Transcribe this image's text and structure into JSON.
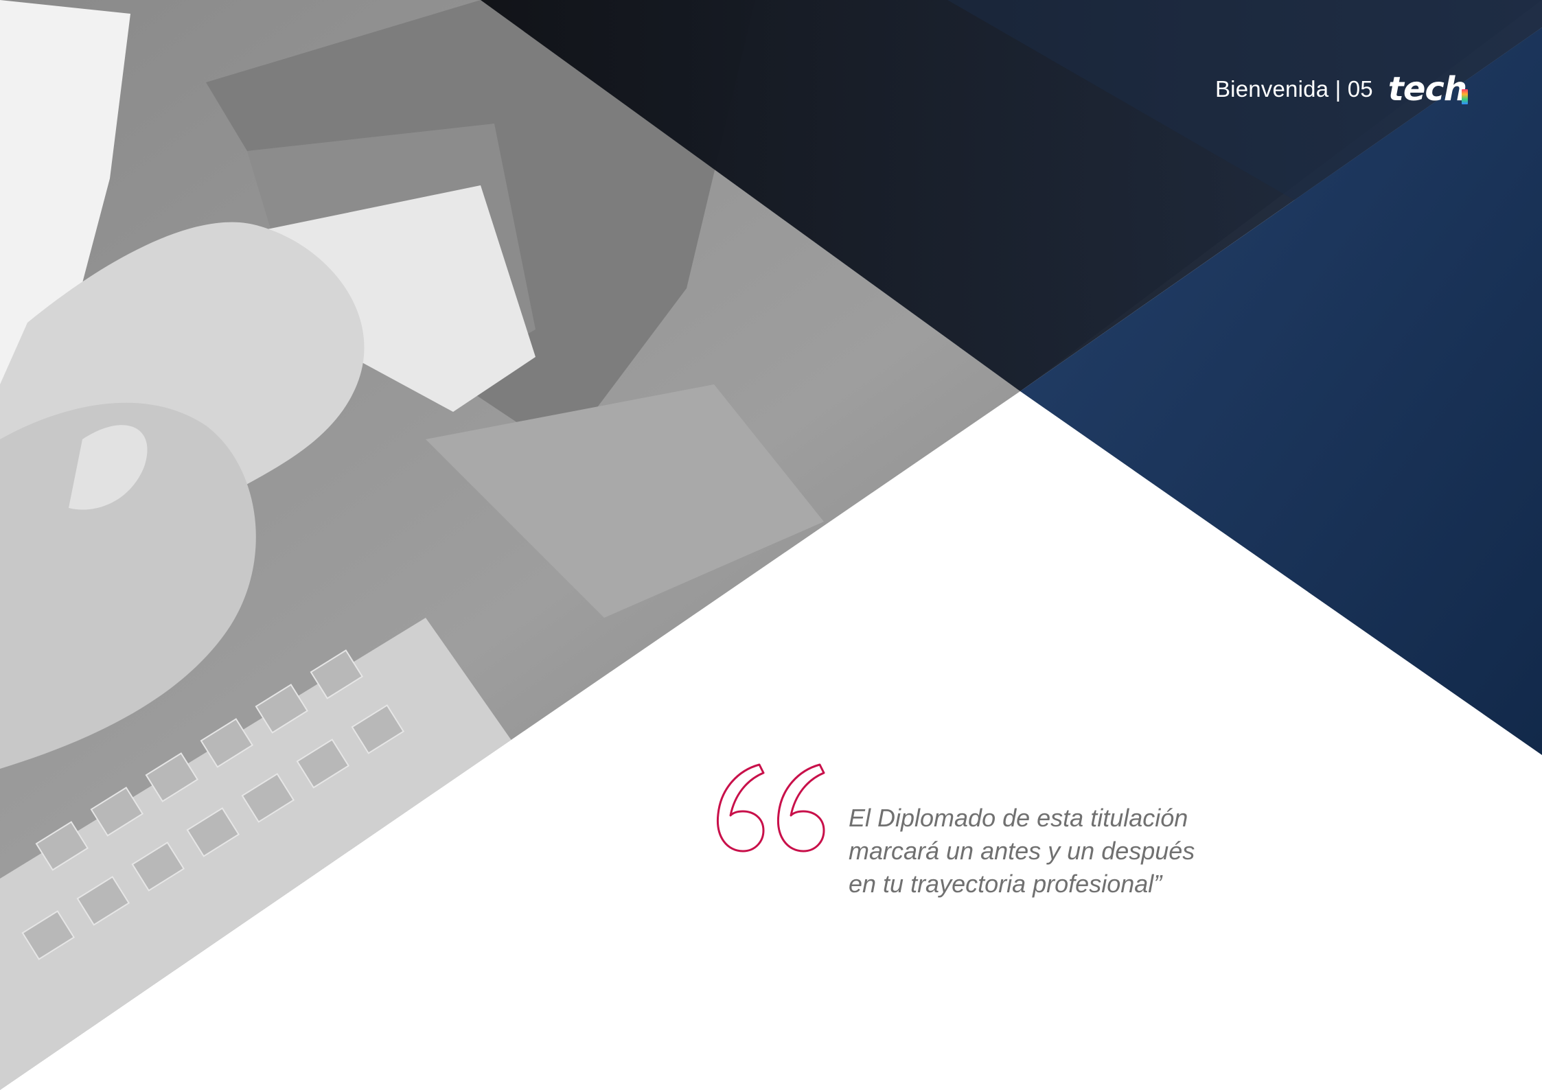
{
  "header": {
    "section_label": "Bienvenida | 05",
    "logo_text": "tech"
  },
  "quote": {
    "lines": [
      "El Diplomado de esta titulación",
      "marcará un antes y un después",
      "en tu trayectoria profesional”"
    ]
  },
  "colors": {
    "navy": "#1b3353",
    "dark_navy": "#111a2b",
    "accent_quote": "#c8104a",
    "quote_text": "#707070"
  },
  "icons": {
    "quote_icon": "opening-quote-icon",
    "logo": "tech-logo"
  }
}
